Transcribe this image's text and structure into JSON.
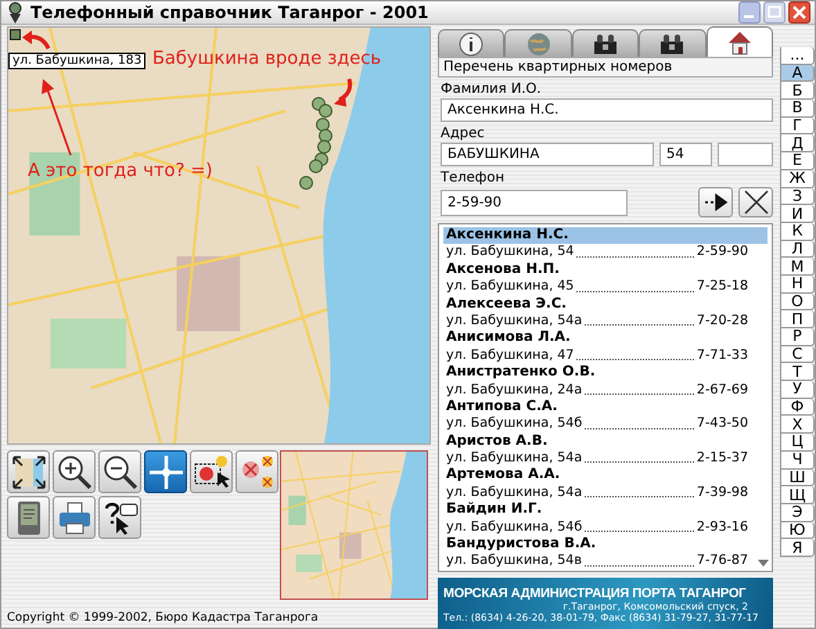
{
  "window": {
    "title": "Телефонный справочник Таганрог - 2001"
  },
  "map": {
    "tooltip": "ул. Бабушкина, 183",
    "annotations": [
      {
        "kind": "upper",
        "text": "Бабушкина вроде здесь"
      },
      {
        "kind": "lower",
        "text": "А это тогда что? =)"
      }
    ]
  },
  "tools": [
    {
      "kind": "fit",
      "selected": false
    },
    {
      "kind": "zoom-in",
      "selected": false
    },
    {
      "kind": "zoom-out",
      "selected": false
    },
    {
      "kind": "pan",
      "selected": true
    },
    {
      "kind": "select",
      "selected": false
    },
    {
      "kind": "clear",
      "selected": false
    },
    {
      "kind": "pda",
      "selected": false
    },
    {
      "kind": "print",
      "selected": false
    },
    {
      "kind": "help",
      "selected": false
    }
  ],
  "copyright": "Copyright © 1999-2002, Бюро Кадастра Таганрога",
  "tabs": [
    {
      "kind": "info",
      "selected": false
    },
    {
      "kind": "globe",
      "selected": false
    },
    {
      "kind": "office",
      "selected": false
    },
    {
      "kind": "phone",
      "selected": false
    },
    {
      "kind": "home",
      "selected": true
    }
  ],
  "panel": {
    "heading": "Перечень квартирных номеров",
    "name_label": "Фамилия И.О.",
    "name_value": "Аксенкина Н.С.",
    "address_label": "Адрес",
    "street_value": "БАБУШКИНА",
    "house_value": "54",
    "phone_label": "Телефон",
    "phone_value": "2-59-90"
  },
  "entries": [
    {
      "name": "Аксенкина Н.С.",
      "address": "ул. Бабушкина, 54",
      "phone": "2-59-90",
      "selected": true
    },
    {
      "name": "Аксенова Н.П.",
      "address": "ул. Бабушкина, 45",
      "phone": "7-25-18",
      "selected": false
    },
    {
      "name": "Алексеева Э.С.",
      "address": "ул. Бабушкина, 54а",
      "phone": "7-20-28",
      "selected": false
    },
    {
      "name": "Анисимова Л.А.",
      "address": "ул. Бабушкина, 47",
      "phone": "7-71-33",
      "selected": false
    },
    {
      "name": "Анистратенко О.В.",
      "address": "ул. Бабушкина, 24а",
      "phone": "2-67-69",
      "selected": false
    },
    {
      "name": "Антипова С.А.",
      "address": "ул. Бабушкина, 54б",
      "phone": "7-43-50",
      "selected": false
    },
    {
      "name": "Аристов А.В.",
      "address": "ул. Бабушкина, 54а",
      "phone": "2-15-37",
      "selected": false
    },
    {
      "name": "Артемова А.А.",
      "address": "ул. Бабушкина, 54а",
      "phone": "7-39-98",
      "selected": false
    },
    {
      "name": "Байдин И.Г.",
      "address": "ул. Бабушкина, 54б",
      "phone": "2-93-16",
      "selected": false
    },
    {
      "name": "Бандуристова В.А.",
      "address": "ул. Бабушкина, 54в",
      "phone": "7-76-87",
      "selected": false
    }
  ],
  "letters": [
    {
      "label": "...",
      "selected": false
    },
    {
      "label": "А",
      "selected": true
    },
    {
      "label": "Б",
      "selected": false
    },
    {
      "label": "В",
      "selected": false
    },
    {
      "label": "Г",
      "selected": false
    },
    {
      "label": "Д",
      "selected": false
    },
    {
      "label": "Е",
      "selected": false
    },
    {
      "label": "Ж",
      "selected": false
    },
    {
      "label": "З",
      "selected": false
    },
    {
      "label": "И",
      "selected": false
    },
    {
      "label": "К",
      "selected": false
    },
    {
      "label": "Л",
      "selected": false
    },
    {
      "label": "М",
      "selected": false
    },
    {
      "label": "Н",
      "selected": false
    },
    {
      "label": "О",
      "selected": false
    },
    {
      "label": "П",
      "selected": false
    },
    {
      "label": "Р",
      "selected": false
    },
    {
      "label": "С",
      "selected": false
    },
    {
      "label": "Т",
      "selected": false
    },
    {
      "label": "У",
      "selected": false
    },
    {
      "label": "Ф",
      "selected": false
    },
    {
      "label": "Х",
      "selected": false
    },
    {
      "label": "Ц",
      "selected": false
    },
    {
      "label": "Ч",
      "selected": false
    },
    {
      "label": "Ш",
      "selected": false
    },
    {
      "label": "Щ",
      "selected": false
    },
    {
      "label": "Э",
      "selected": false
    },
    {
      "label": "Ю",
      "selected": false
    },
    {
      "label": "Я",
      "selected": false
    }
  ],
  "banner": {
    "title": "МОРСКАЯ АДМИНИСТРАЦИЯ ПОРТА ТАГАНРОГ",
    "address": "г.Таганрог, Комсомольский спуск, 2",
    "contacts": "Тел.: (8634) 4-26-20, 38-01-79, Факс (8634) 31-79-27, 31-77-17"
  }
}
